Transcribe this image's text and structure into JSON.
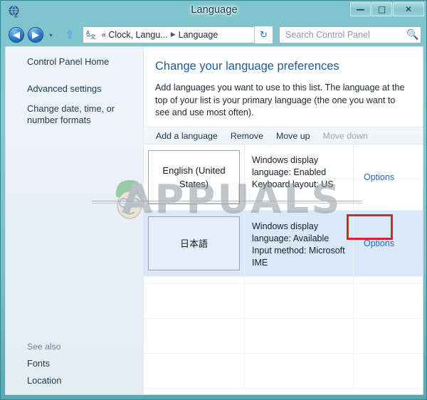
{
  "window": {
    "title": "Language",
    "icon": "language-globe-icon",
    "caption": {
      "minimize_label": "—",
      "maximize_label": "□",
      "close_label": "✕"
    }
  },
  "navbar": {
    "back_label": "◀",
    "forward_label": "▶",
    "recent_label": "▾",
    "up_label": "⇧",
    "address": {
      "icon": "control-panel-language-icon",
      "separator": "«",
      "crumb_parent": "Clock, Langu...",
      "crumb_arrow": "▶",
      "crumb_current": "Language",
      "dropdown_label": "▾"
    },
    "refresh_label": "↻",
    "search": {
      "placeholder": "Search Control Panel",
      "value": "",
      "icon": "search-icon"
    }
  },
  "sidebar": {
    "links": [
      {
        "label": "Control Panel Home"
      },
      {
        "label": "Advanced settings"
      },
      {
        "label": "Change date, time, or number formats"
      }
    ],
    "see_also": {
      "heading": "See also",
      "links": [
        {
          "label": "Fonts"
        },
        {
          "label": "Location"
        }
      ]
    }
  },
  "main": {
    "heading": "Change your language preferences",
    "description": "Add languages you want to use to this list. The language at the top of your list is your primary language (the one you want to see and use most often).",
    "command_bar": [
      {
        "label": "Add a language",
        "enabled": true
      },
      {
        "label": "Remove",
        "enabled": true
      },
      {
        "label": "Move up",
        "enabled": true
      },
      {
        "label": "Move down",
        "enabled": false
      }
    ],
    "language_rows": [
      {
        "name": "English (United States)",
        "details": "Windows display language: Enabled\nKeyboard layout: US",
        "detail_lines": [
          "Windows display",
          "language: Enabled",
          "Keyboard layout: US"
        ],
        "options_label": "Options",
        "selected": false
      },
      {
        "name": "日本語",
        "details": "Windows display language: Available\nInput method: Microsoft IME",
        "detail_lines": [
          "Windows display",
          "language: Available",
          "Input method: Microsoft",
          "IME"
        ],
        "options_label": "Options",
        "selected": true
      }
    ]
  },
  "annotation": {
    "target": "options-link-japanese",
    "color": "#d42828"
  },
  "watermark": {
    "text": "APPUALS"
  },
  "colors": {
    "accent": "#1f6bb5",
    "heading": "#1f5d98",
    "frame": "#79bdc8",
    "selection": "#dbe8f7",
    "annotation": "#d42828"
  }
}
